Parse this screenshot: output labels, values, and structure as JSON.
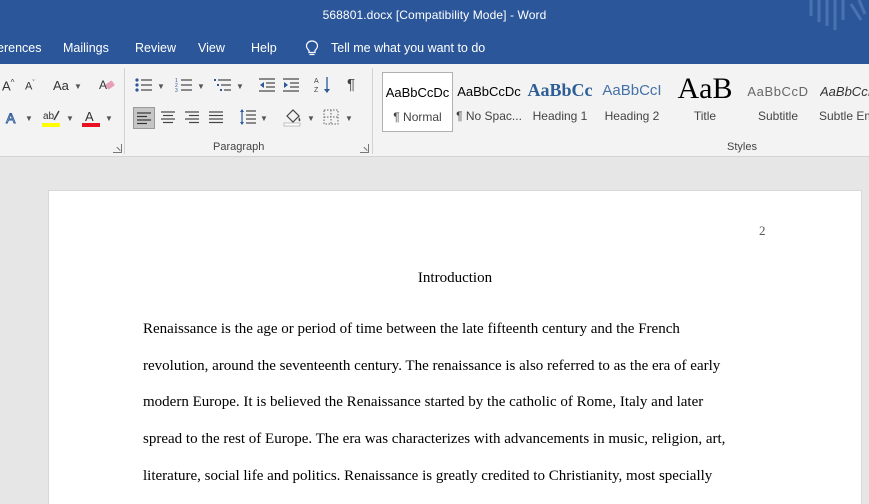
{
  "titlebar": {
    "title": "568801.docx [Compatibility Mode]  -  Word"
  },
  "menubar": {
    "tabs": [
      {
        "label": "erences"
      },
      {
        "label": "Mailings"
      },
      {
        "label": "Review"
      },
      {
        "label": "View"
      },
      {
        "label": "Help"
      }
    ],
    "tell_me": "Tell me what you want to do"
  },
  "ribbon": {
    "font": {
      "grow_label": "A",
      "shrink_label": "A",
      "case_label": "Aa"
    },
    "paragraph_group_label": "Paragraph",
    "styles_group_label": "Styles",
    "styles": [
      {
        "preview": "AaBbCcDc",
        "name": "¶ Normal"
      },
      {
        "preview": "AaBbCcDc",
        "name": "¶ No Spac..."
      },
      {
        "preview": "AaBbCc",
        "name": "Heading 1"
      },
      {
        "preview": "AaBbCcI",
        "name": "Heading 2"
      },
      {
        "preview": "AaB",
        "name": "Title"
      },
      {
        "preview": "AaBbCcD",
        "name": "Subtitle"
      },
      {
        "preview": "AaBbCcI",
        "name": "Subtle Em"
      }
    ],
    "colors": {
      "highlight": "#ffff00",
      "font_color": "#e81123",
      "accent": "#2b579a"
    }
  },
  "document": {
    "page_number": "2",
    "title": "Introduction",
    "lines": [
      "Renaissance is the age or period of time between the late fifteenth century and the French",
      "revolution, around the seventeenth century. The renaissance is also referred to as the era of early",
      "modern Europe. It is believed the Renaissance started by the catholic of Rome, Italy and later",
      "spread to the rest of Europe. The era was characterizes with advancements in music, religion, art,",
      "literature, social life and politics. Renaissance is greatly credited to Christianity, most specially"
    ]
  }
}
